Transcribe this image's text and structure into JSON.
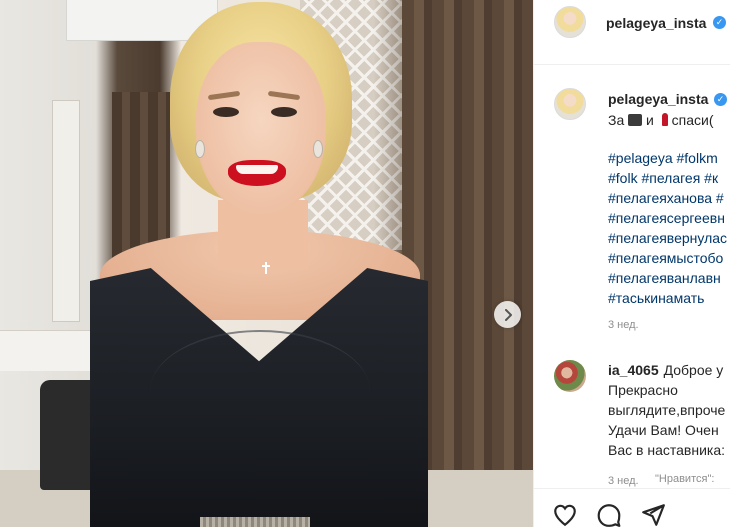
{
  "post": {
    "username": "pelageya_insta",
    "verified_icon": "verified-badge-icon",
    "caption_prefix": "За",
    "caption_mid": "и",
    "caption_suffix": "спаси(",
    "caption_icons": [
      "camera-emoji-icon",
      "lipstick-emoji-icon"
    ],
    "hashtags": [
      "#pelageya #folkm",
      "#folk #пелагея #к",
      "#пелагеяханова #",
      "#пелагеясергеевн",
      "#пелагеявернулас",
      "#пелагеямыстобо",
      "#пелагеяванлавн",
      "#таськинамать"
    ],
    "time": "3 нед."
  },
  "comment": {
    "username": "ia_4065",
    "first_line": "Доброе у",
    "lines": [
      "Прекрасно",
      "выглядите,впроче",
      "Удачи Вам! Очен",
      "Вас в наставника:"
    ],
    "time": "3 нед.",
    "like_label": "\"Нравится\":"
  },
  "colors": {
    "link": "#00376b",
    "text": "#262626",
    "muted": "#8e8e8e",
    "verified": "#3897f0",
    "lipstick": "#cc1020"
  },
  "icons": {
    "next": "chevron-right-icon",
    "like": "heart-icon",
    "comment": "comment-bubble-icon",
    "share": "paper-plane-icon"
  }
}
